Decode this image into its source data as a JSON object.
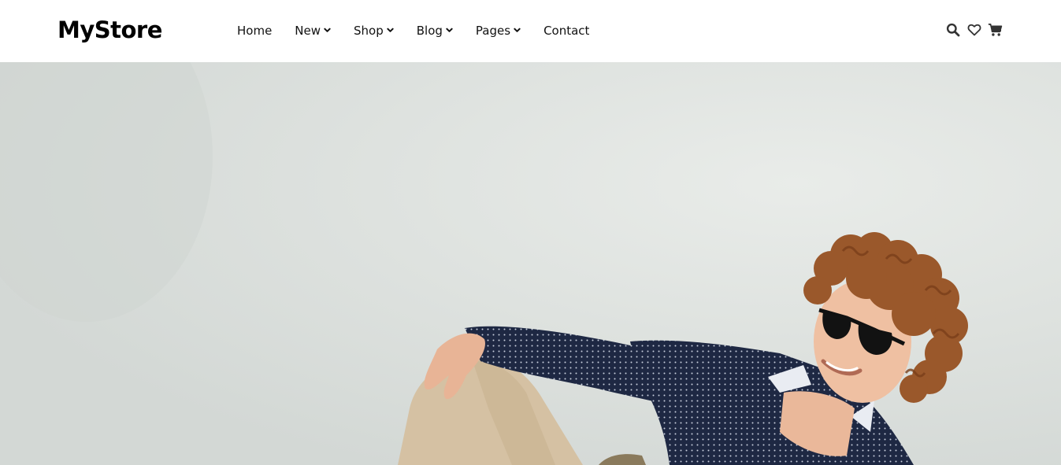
{
  "header": {
    "logo": "MyStore",
    "nav": [
      {
        "label": "Home",
        "dropdown": false
      },
      {
        "label": "New",
        "dropdown": true
      },
      {
        "label": "Shop",
        "dropdown": true
      },
      {
        "label": "Blog",
        "dropdown": true
      },
      {
        "label": "Pages",
        "dropdown": true
      },
      {
        "label": "Contact",
        "dropdown": false
      }
    ],
    "icons": [
      "search-icon",
      "heart-icon",
      "cart-icon"
    ]
  },
  "colors": {
    "text": "#111111",
    "header_bg": "#ffffff",
    "hero_bg": "#dfe3e0",
    "shirt": "#1f2a44",
    "pants": "#d8c3a6",
    "hair": "#9c5a2c"
  }
}
